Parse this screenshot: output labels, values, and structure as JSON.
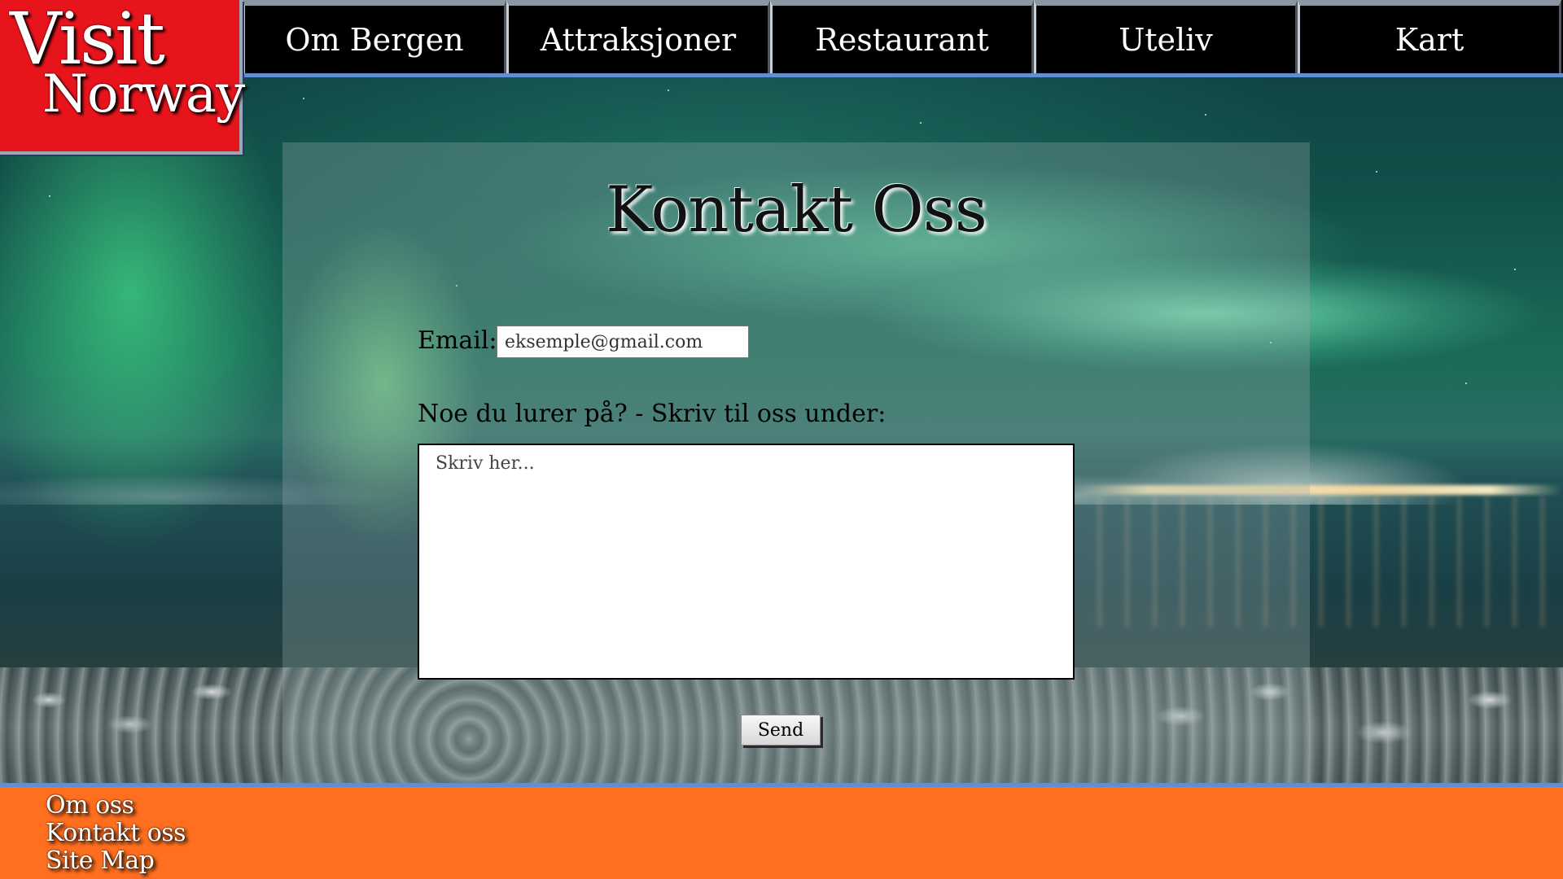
{
  "logo": {
    "line1": "Visit",
    "line2": "Norway"
  },
  "nav": {
    "items": [
      {
        "label": "Om Bergen"
      },
      {
        "label": "Attraksjoner"
      },
      {
        "label": "Restaurant"
      },
      {
        "label": "Uteliv"
      },
      {
        "label": "Kart"
      }
    ]
  },
  "contact": {
    "title": "Kontakt Oss",
    "email_label": "Email:",
    "email_placeholder": "eksemple@gmail.com",
    "question_label": "Noe du lurer på? - Skriv til oss under:",
    "message_placeholder": "Skriv her...",
    "send_label": "Send"
  },
  "footer": {
    "links": [
      {
        "label": "Om oss"
      },
      {
        "label": "Kontakt oss"
      },
      {
        "label": "Site Map"
      }
    ]
  },
  "colors": {
    "logo_red": "#e8141c",
    "nav_background": "#000000",
    "accent_blue": "#5f8fd0",
    "footer_orange": "#ff6f1f"
  }
}
